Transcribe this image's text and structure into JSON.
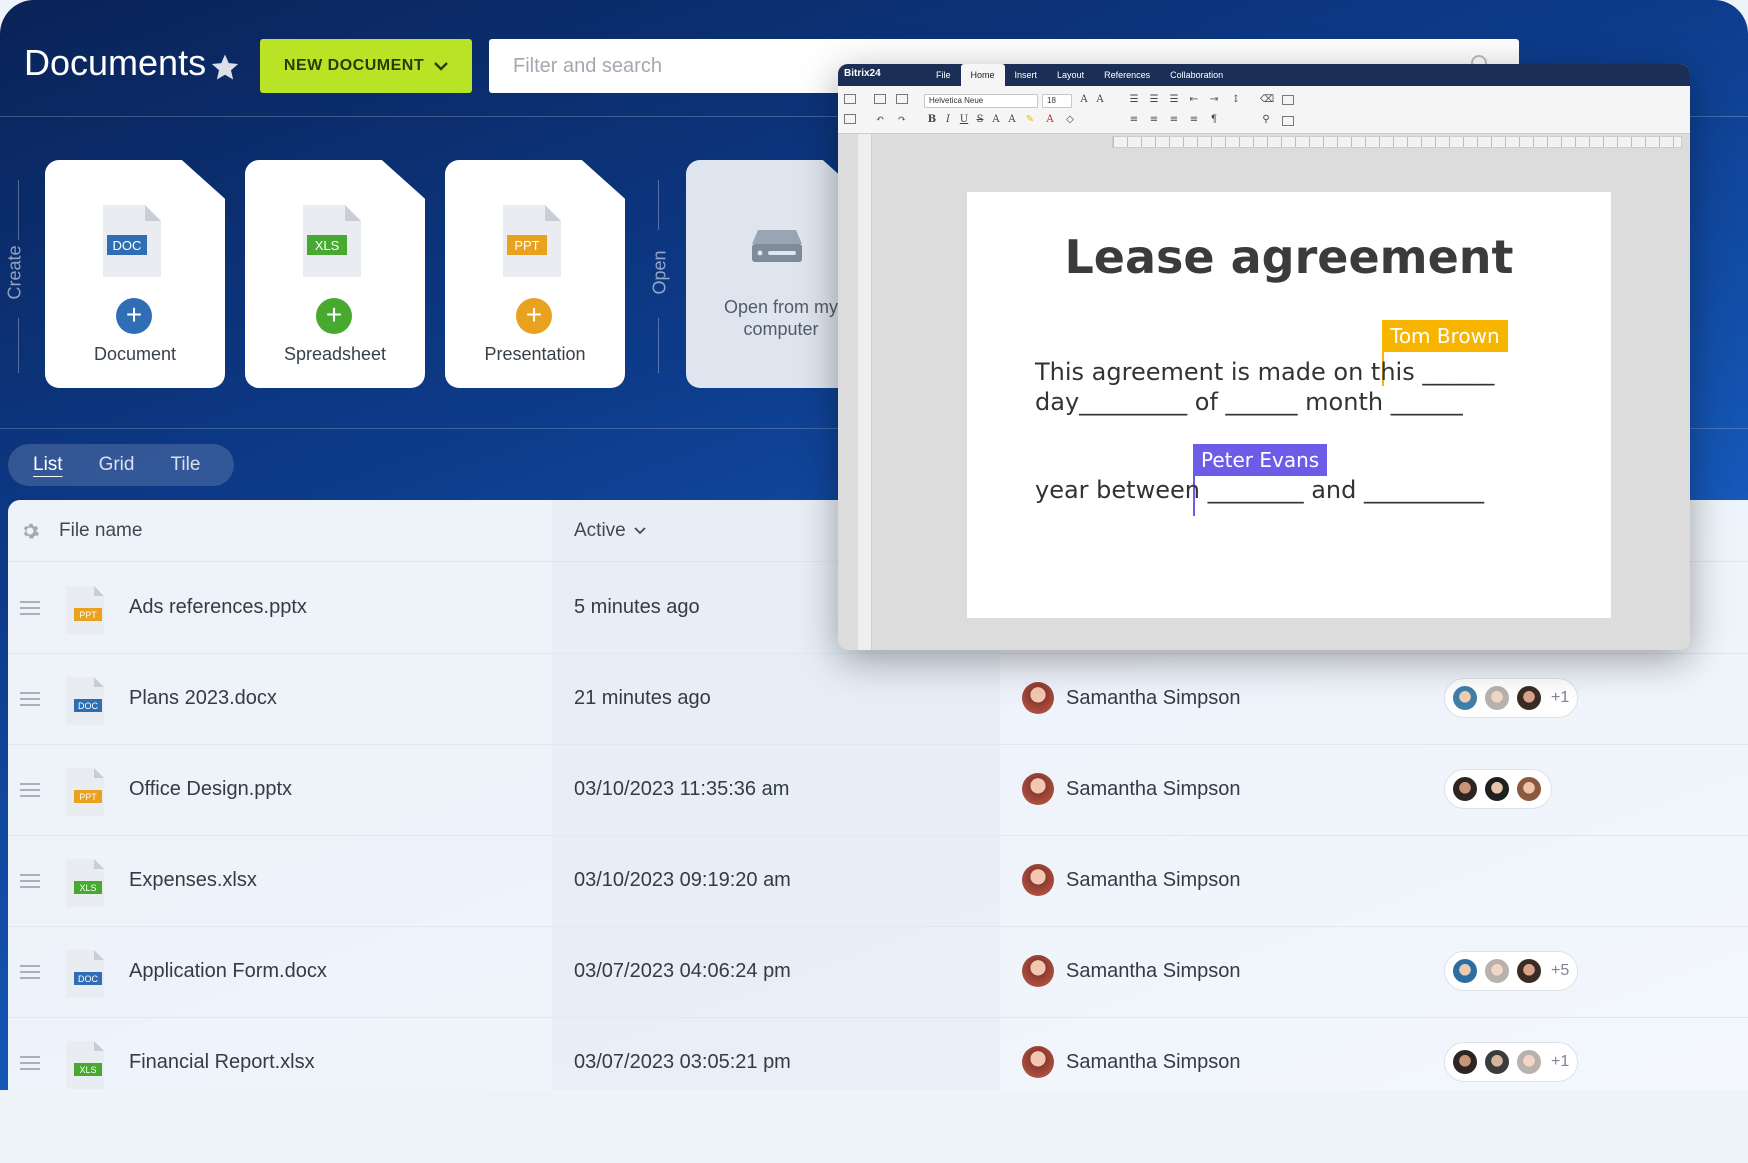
{
  "header": {
    "title": "Documents",
    "new_document_label": "NEW DOCUMENT",
    "search_placeholder": "Filter and search"
  },
  "create_section": {
    "label": "Create",
    "cards": [
      {
        "label": "Document",
        "badge": "DOC",
        "color": "#2f6eb5"
      },
      {
        "label": "Spreadsheet",
        "badge": "XLS",
        "color": "#47a930"
      },
      {
        "label": "Presentation",
        "badge": "PPT",
        "color": "#e8a220"
      }
    ]
  },
  "open_section": {
    "label": "Open",
    "card_label": "Open from my computer"
  },
  "views": [
    "List",
    "Grid",
    "Tile"
  ],
  "active_view": "List",
  "table": {
    "col_name": "File name",
    "col_active": "Active",
    "rows": [
      {
        "name": "Ads references.pptx",
        "type": "PPT",
        "active": "5 minutes ago",
        "owner": "",
        "shared_more": ""
      },
      {
        "name": "Plans 2023.docx",
        "type": "DOC",
        "active": "21 minutes ago",
        "owner": "Samantha Simpson",
        "shared_more": "+1"
      },
      {
        "name": "Office Design.pptx",
        "type": "PPT",
        "active": "03/10/2023 11:35:36 am",
        "owner": "Samantha Simpson",
        "shared_more": ""
      },
      {
        "name": "Expenses.xlsx",
        "type": "XLS",
        "active": "03/10/2023 09:19:20 am",
        "owner": "Samantha Simpson",
        "shared_more": ""
      },
      {
        "name": "Application Form.docx",
        "type": "DOC",
        "active": "03/07/2023 04:06:24 pm",
        "owner": "Samantha Simpson",
        "shared_more": "+5"
      },
      {
        "name": "Financial Report.xlsx",
        "type": "XLS",
        "active": "03/07/2023 03:05:21 pm",
        "owner": "Samantha Simpson",
        "shared_more": "+1"
      }
    ]
  },
  "editor": {
    "brand": "Bitrix24",
    "tabs": [
      "File",
      "Home",
      "Insert",
      "Layout",
      "References",
      "Collaboration"
    ],
    "active_tab": "Home",
    "font_name": "Helvetica Neue",
    "font_size": "18",
    "doc_title": "Lease agreement",
    "line1": "This agreement is made on this ______",
    "line2": "day_________  of ______ month ______",
    "line3": "year between ________ and __________",
    "cursor_tom": "Tom Brown",
    "cursor_peter": "Peter Evans"
  },
  "colors": {
    "accent_green": "#b9e426",
    "doc_blue": "#2f6eb5",
    "xls_green": "#47a930",
    "ppt_orange": "#e8a220"
  }
}
